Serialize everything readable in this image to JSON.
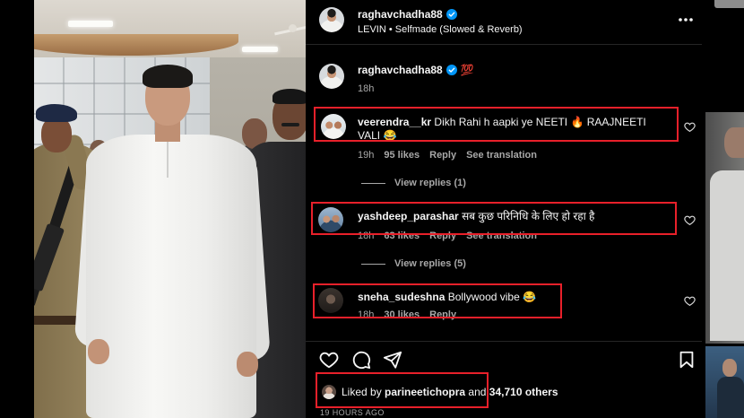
{
  "header": {
    "username": "raghavchadha88",
    "verified": true,
    "audio_label": "LEVIN • Selfmade (Slowed & Reverb)"
  },
  "caption": {
    "username": "raghavchadha88",
    "text": "💯",
    "time": "18h"
  },
  "comments": [
    {
      "username": "veerendra__kr",
      "text": "Dikh Rahi h aapki ye NEETI 🔥 RAAJNEETI VALI 😂",
      "time": "19h",
      "likes": "95 likes",
      "reply": "Reply",
      "translate": "See translation",
      "view_replies": "View replies (1)"
    },
    {
      "username": "yashdeep_parashar",
      "text": "सब कुछ परिनिधि के लिए हो रहा है",
      "time": "18h",
      "likes": "63 likes",
      "reply": "Reply",
      "translate": "See translation",
      "view_replies": "View replies (5)"
    },
    {
      "username": "sneha_sudeshna",
      "text": "Bollywood vibe 😂",
      "time": "18h",
      "likes": "30 likes",
      "reply": "Reply"
    }
  ],
  "likes": {
    "prefix": "Liked by",
    "user": "parineetichopra",
    "connector": "and",
    "count": "34,710 others"
  },
  "timestamp": "19 HOURS AGO",
  "icons": {
    "more": "more-options-icon",
    "verified": "verified-badge-icon",
    "comment_like": "heart-icon",
    "like": "heart-icon",
    "comment": "comment-icon",
    "share": "share-icon",
    "save": "bookmark-icon"
  },
  "theme": {
    "background": "#000000",
    "text": "#f5f5f5",
    "secondary_text": "#a8a8a8",
    "verified": "#0095f6",
    "highlight": "#e8202a",
    "divider": "#262626"
  }
}
